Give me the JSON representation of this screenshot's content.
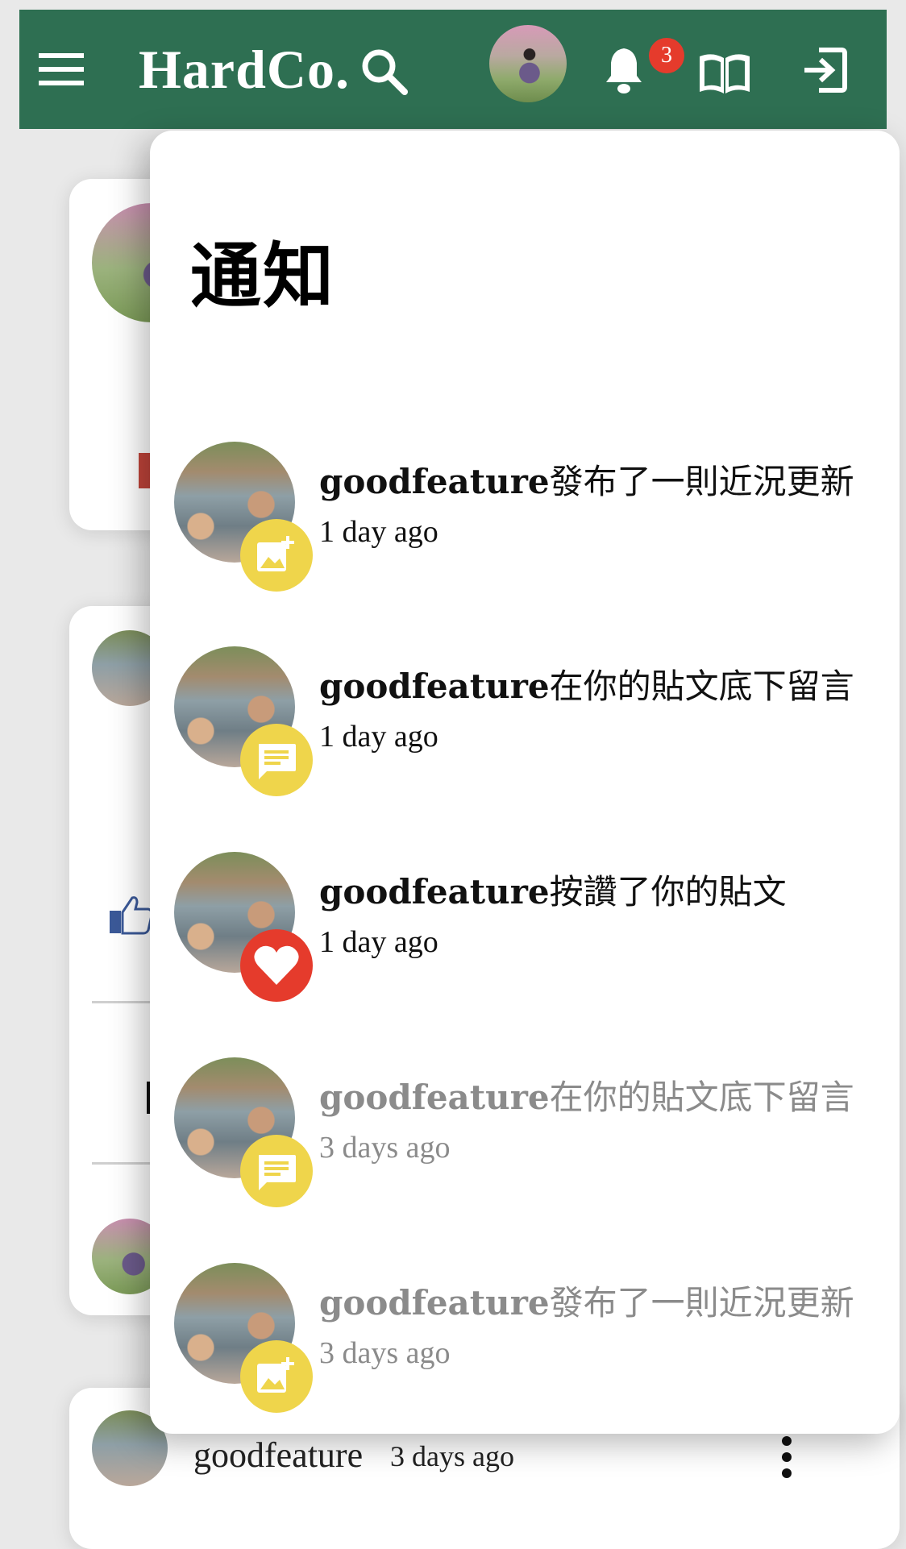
{
  "navbar": {
    "brand": "HardCo.",
    "notification_count": "3",
    "bg_color": "#2e6f52",
    "icons": [
      "menu-icon",
      "search-icon",
      "bell-icon",
      "book-icon",
      "logout-icon"
    ]
  },
  "notifications_panel": {
    "title": "通知",
    "items": [
      {
        "username": "goodfeature",
        "action": "發布了一則近況更新",
        "time": "1 day ago",
        "type": "post-update",
        "read": false
      },
      {
        "username": "goodfeature",
        "action": "在你的貼文底下留言",
        "time": "1 day ago",
        "type": "comment",
        "read": false
      },
      {
        "username": "goodfeature",
        "action": "按讚了你的貼文",
        "time": "1 day ago",
        "type": "like",
        "read": false
      },
      {
        "username": "goodfeature",
        "action": "在你的貼文底下留言",
        "time": "3 days ago",
        "type": "comment",
        "read": true
      },
      {
        "username": "goodfeature",
        "action": "發布了一則近況更新",
        "time": "3 days ago",
        "type": "post-update",
        "read": true
      }
    ]
  },
  "feed": {
    "bottom_post": {
      "username": "goodfeature",
      "time": "3 days ago"
    }
  },
  "colors": {
    "accent_yellow": "#efd54b",
    "like_red": "#e53b2c"
  }
}
